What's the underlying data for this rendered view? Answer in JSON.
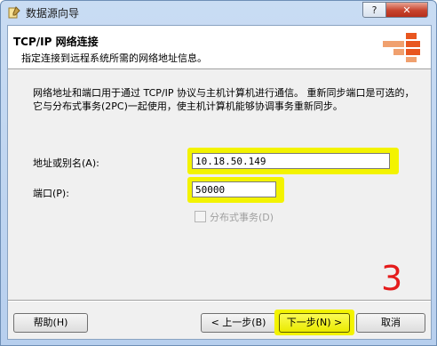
{
  "window": {
    "title": "数据源向导",
    "help_label": "?",
    "close_label": "✕"
  },
  "header": {
    "title": "TCP/IP 网络连接",
    "subtitle": "指定连接到远程系统所需的网络地址信息。"
  },
  "description": "网络地址和端口用于通过 TCP/IP 协议与主机计算机进行通信。 重新同步端口是可选的，它与分布式事务(2PC)一起使用，使主机计算机能够协调事务重新同步。",
  "form": {
    "address_label": "地址或别名(A):",
    "address_value": "10.18.50.149",
    "port_label": "端口(P):",
    "port_value": "50000",
    "distributed_label": "分布式事务(D)",
    "distributed_checked": false
  },
  "annotation": {
    "step_number": "3"
  },
  "buttons": {
    "help": "帮助(H)",
    "back": "< 上一步(B)",
    "next": "下一步(N) >",
    "cancel": "取消"
  },
  "colors": {
    "highlight": "#f3f300",
    "annotation": "#e41b1b",
    "logo": "#e8561f"
  }
}
